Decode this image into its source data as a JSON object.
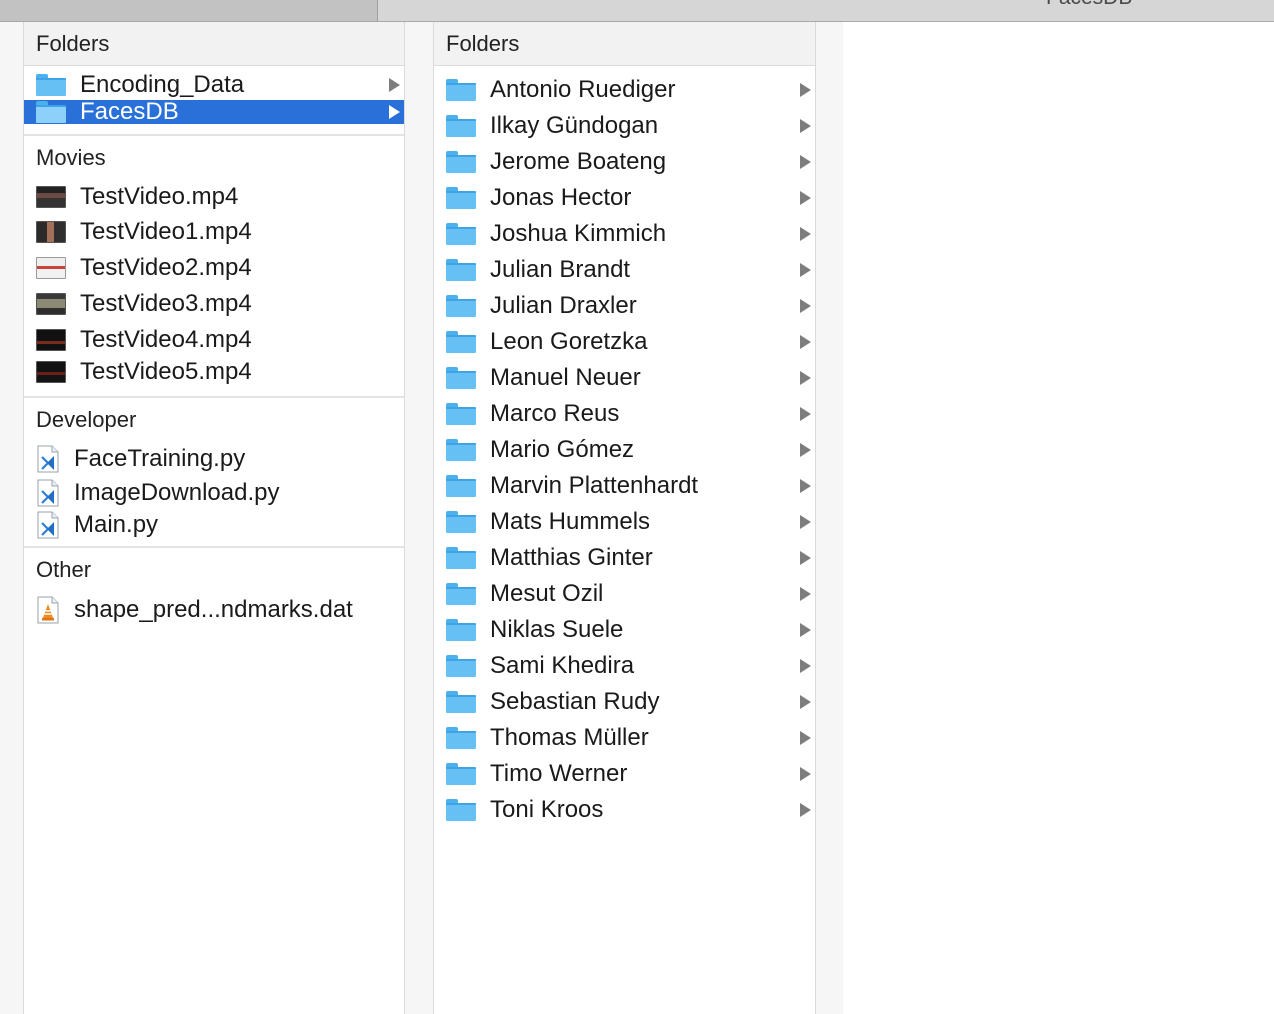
{
  "window": {
    "tab_right_title": "FacesDB"
  },
  "left_column": {
    "folders_header": "Folders",
    "folders": [
      {
        "label": "Encoding_Data",
        "selected": false
      },
      {
        "label": "FacesDB",
        "selected": true
      }
    ],
    "movies_header": "Movies",
    "movies": [
      {
        "label": "TestVideo.mp4"
      },
      {
        "label": "TestVideo1.mp4"
      },
      {
        "label": "TestVideo2.mp4"
      },
      {
        "label": "TestVideo3.mp4"
      },
      {
        "label": "TestVideo4.mp4"
      },
      {
        "label": "TestVideo5.mp4"
      }
    ],
    "developer_header": "Developer",
    "developer": [
      {
        "label": "FaceTraining.py"
      },
      {
        "label": "ImageDownload.py"
      },
      {
        "label": "Main.py"
      }
    ],
    "other_header": "Other",
    "other": [
      {
        "label": "shape_pred...ndmarks.dat"
      }
    ]
  },
  "right_column": {
    "folders_header": "Folders",
    "folders": [
      {
        "label": "Antonio Ruediger"
      },
      {
        "label": "Ilkay Gündogan"
      },
      {
        "label": "Jerome Boateng"
      },
      {
        "label": "Jonas Hector"
      },
      {
        "label": "Joshua Kimmich"
      },
      {
        "label": "Julian Brandt"
      },
      {
        "label": "Julian Draxler"
      },
      {
        "label": "Leon Goretzka"
      },
      {
        "label": "Manuel Neuer"
      },
      {
        "label": "Marco Reus"
      },
      {
        "label": "Mario Gómez"
      },
      {
        "label": "Marvin Plattenhardt"
      },
      {
        "label": "Mats Hummels"
      },
      {
        "label": "Matthias Ginter"
      },
      {
        "label": "Mesut Ozil"
      },
      {
        "label": "Niklas Suele"
      },
      {
        "label": "Sami Khedira"
      },
      {
        "label": "Sebastian Rudy"
      },
      {
        "label": "Thomas Müller"
      },
      {
        "label": "Timo Werner"
      },
      {
        "label": "Toni Kroos"
      }
    ]
  },
  "colors": {
    "selection": "#2a70d9",
    "folder": "#67c0f4",
    "arrow": "#7d7d7d"
  },
  "icons": {
    "folder": "folder-icon",
    "video": "video-thumbnail-icon",
    "python": "python-file-icon",
    "dat": "vlc-cone-file-icon",
    "disclosure": "disclosure-arrow-icon"
  }
}
